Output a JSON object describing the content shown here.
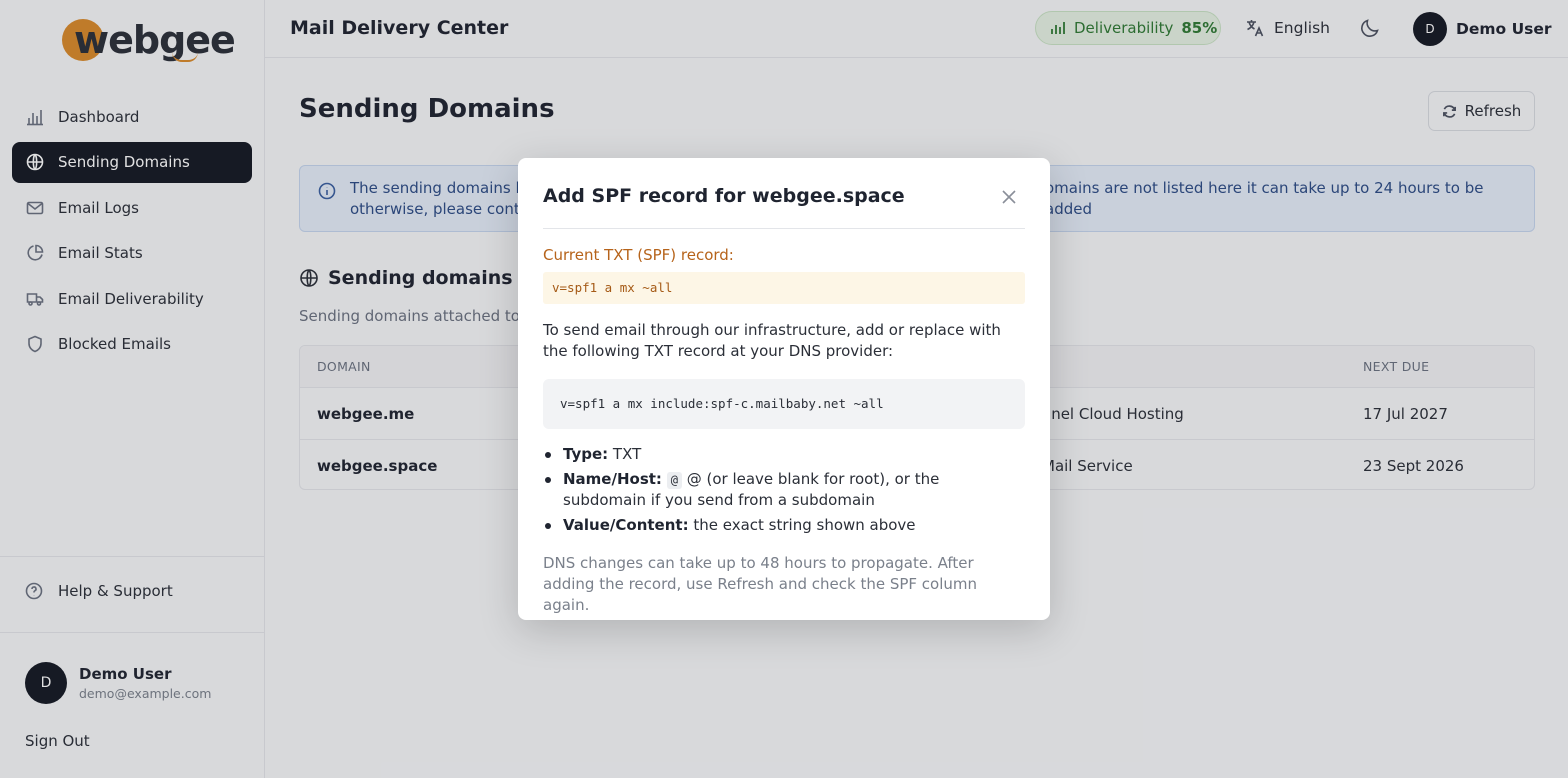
{
  "brand": {
    "logo_text": "webgee"
  },
  "sidebar": {
    "items": [
      {
        "label": "Dashboard",
        "icon": "bar-chart-icon",
        "active": false
      },
      {
        "label": "Sending Domains",
        "icon": "globe-icon",
        "active": true
      },
      {
        "label": "Email Logs",
        "icon": "mail-icon",
        "active": false
      },
      {
        "label": "Email Stats",
        "icon": "pie-chart-icon",
        "active": false
      },
      {
        "label": "Email Deliverability",
        "icon": "truck-icon",
        "active": false
      },
      {
        "label": "Blocked Emails",
        "icon": "shield-icon",
        "active": false
      }
    ],
    "help": "Help & Support",
    "user": {
      "initial": "D",
      "name": "Demo User",
      "email": "demo@example.com"
    },
    "signout": "Sign Out"
  },
  "header": {
    "title": "Mail Delivery Center",
    "deliverability_label": "Deliverability",
    "deliverability_value": "85%",
    "language": "English",
    "user_initial": "D",
    "user_name": "Demo User"
  },
  "main": {
    "page_title": "Sending Domains",
    "refresh_label": "Refresh",
    "info_text_left": "The sending domains lis",
    "info_text_right": "omains are not listed here it can take up to 24 hours to be added",
    "info_text_line2": "otherwise, please conta",
    "section_title": "Sending domains or",
    "section_sub": "Sending domains attached to",
    "table": {
      "columns": {
        "domain": "DOMAIN",
        "next_due": "NEXT DUE"
      },
      "rows": [
        {
          "domain": "webgee.me",
          "service": "anel Cloud Hosting",
          "next_due": "17 Jul 2027"
        },
        {
          "domain": "webgee.space",
          "service": "Mail Service",
          "next_due": "23 Sept 2026"
        }
      ]
    }
  },
  "modal": {
    "title": "Add SPF record for webgee.space",
    "current_label": "Current TXT (SPF) record:",
    "current_record": "v=spf1 a mx ~all",
    "instructions": "To send email through our infrastructure, add or replace with the following TXT record at your DNS provider:",
    "new_record": "v=spf1 a mx include:spf-c.mailbaby.net ~all",
    "details": {
      "type_label": "Type:",
      "type_value": "TXT",
      "name_label": "Name/Host:",
      "name_chip": "@",
      "name_value": "@ (or leave blank for root), or the subdomain if you send from a subdomain",
      "value_label": "Value/Content:",
      "value_value": "the exact string shown above"
    },
    "footnote": "DNS changes can take up to 48 hours to propagate. After adding the record, use Refresh and check the SPF column again."
  },
  "colors": {
    "active_nav": "#141923",
    "accent_orange": "#d98a2b",
    "deliverability_green": "#2f7a34",
    "info_blue": "#2d4c86"
  }
}
